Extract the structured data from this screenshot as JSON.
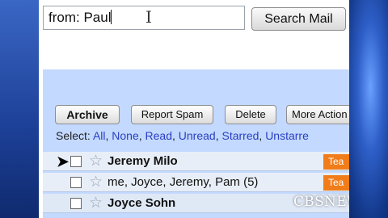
{
  "search": {
    "value": "from: Paul",
    "button_label": "Search Mail"
  },
  "toolbar": {
    "archive_label": "Archive",
    "report_spam_label": "Report Spam",
    "delete_label": "Delete",
    "more_actions_label": "More Action"
  },
  "select": {
    "prefix": "Select:",
    "options": [
      "All",
      "None",
      "Read",
      "Unread",
      "Starred",
      "Unstarre"
    ]
  },
  "messages": [
    {
      "sender": "Jeremy Milo",
      "unread": true,
      "label": "Tea",
      "selected_pointer": true
    },
    {
      "sender": "me, Joyce, Jeremy, Pam (5)",
      "unread": false,
      "label": "Tea"
    },
    {
      "sender": "Joyce Sohn",
      "unread": true,
      "label": ""
    }
  ],
  "watermark": "CBSNEWS.com",
  "colors": {
    "toolbar_bg": "#c3d9ff",
    "link": "#2a3fc0",
    "label_tag": "#f07c1a"
  },
  "icons": {
    "star": "star-icon",
    "pointer": "pointer-arrow-icon",
    "cursor": "text-cursor-icon"
  }
}
